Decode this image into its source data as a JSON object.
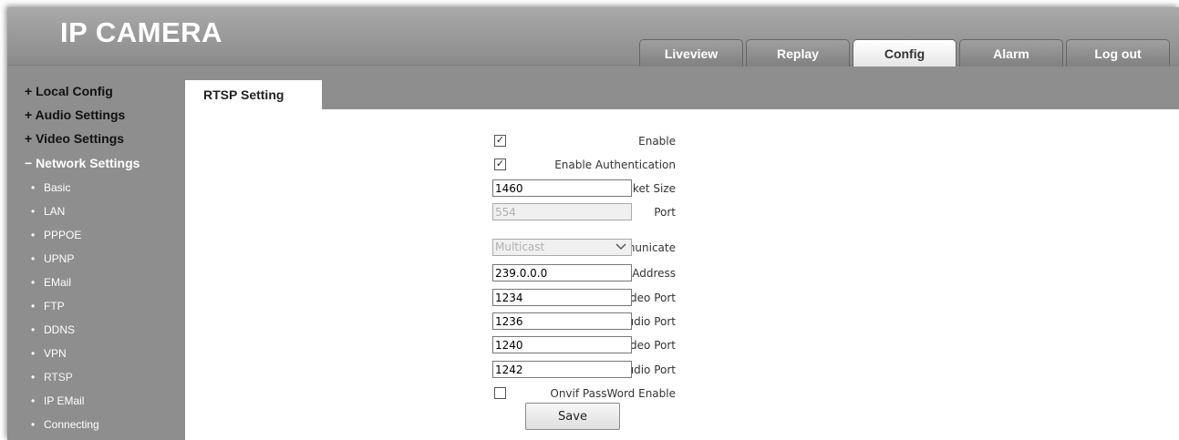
{
  "header": {
    "logo": "IP CAMERA",
    "tabs": [
      {
        "label": "Liveview",
        "active": false
      },
      {
        "label": "Replay",
        "active": false
      },
      {
        "label": "Config",
        "active": true
      },
      {
        "label": "Alarm",
        "active": false
      },
      {
        "label": "Log out",
        "active": false
      }
    ]
  },
  "sidebar": {
    "groups": [
      {
        "label": "+ Local Config"
      },
      {
        "label": "+ Audio Settings"
      },
      {
        "label": "+ Video Settings"
      },
      {
        "label": "− Network Settings"
      }
    ],
    "network_items": [
      {
        "label": "Basic"
      },
      {
        "label": "LAN"
      },
      {
        "label": "PPPOE"
      },
      {
        "label": "UPNP"
      },
      {
        "label": "EMail"
      },
      {
        "label": "FTP"
      },
      {
        "label": "DDNS"
      },
      {
        "label": "VPN"
      },
      {
        "label": "RTSP",
        "active": true
      },
      {
        "label": "IP EMail"
      },
      {
        "label": "Connecting"
      }
    ]
  },
  "section_tab": "RTSP Setting",
  "form": {
    "enable": {
      "label": "Enable",
      "checked": true
    },
    "enable_auth": {
      "label": "Enable Authentication",
      "checked": true
    },
    "packet_size": {
      "label": "Packet Size",
      "value": "1460"
    },
    "port": {
      "label": "Port",
      "value": "554"
    },
    "communicate": {
      "label": "Communicate",
      "value": "Multicast"
    },
    "multicast_server": {
      "label": "Multicast Server Address",
      "value": "239.0.0.0"
    },
    "main_video_port": {
      "label": "Main Stream Multicast Video Port",
      "value": "1234"
    },
    "main_audio_port": {
      "label": "Main Stream Multicast Audio Port",
      "value": "1236"
    },
    "sub_video_port": {
      "label": "Sub Stream Multicast Video Port",
      "value": "1240"
    },
    "sub_audio_port": {
      "label": "Sub Stream Multicast Audio Port",
      "value": "1242"
    },
    "onvif_pw": {
      "label": "Onvif PassWord Enable",
      "checked": false
    },
    "save_label": "Save"
  },
  "icons": {
    "checkmark": "checkmark-icon",
    "dropdown": "chevron-down-icon"
  }
}
